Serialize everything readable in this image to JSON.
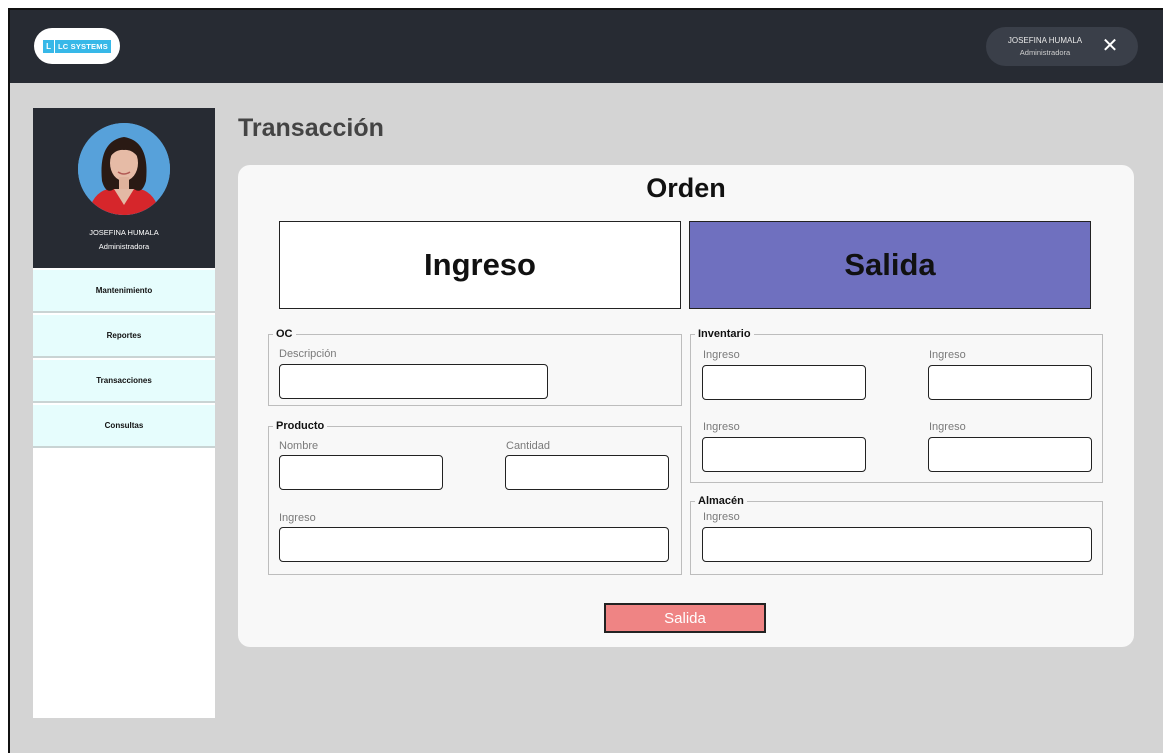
{
  "header": {
    "logo": {
      "mark": "L",
      "text": "LC SYSTEMS"
    },
    "user": {
      "name": "JOSEFINA HUMALA",
      "role": "Administradora"
    },
    "close_icon": "✕"
  },
  "sidebar": {
    "profile": {
      "name": "JOSEFINA HUMALA",
      "role": "Administradora",
      "avatar": "profile-photo"
    },
    "items": [
      {
        "label": "Mantenimiento"
      },
      {
        "label": "Reportes"
      },
      {
        "label": "Transacciones"
      },
      {
        "label": "Consultas"
      }
    ]
  },
  "main": {
    "page_title": "Transacción",
    "card": {
      "title": "Orden",
      "tabs": {
        "ingreso": "Ingreso",
        "salida": "Salida"
      },
      "oc": {
        "legend": "OC",
        "descripcion_label": "Descripción",
        "descripcion_value": ""
      },
      "producto": {
        "legend": "Producto",
        "nombre_label": "Nombre",
        "cantidad_label": "Cantidad",
        "ingreso_label": "Ingreso"
      },
      "inventario": {
        "legend": "Inventario",
        "labels": [
          "Ingreso",
          "Ingreso",
          "Ingreso",
          "Ingreso"
        ]
      },
      "almacen": {
        "legend": "Almacén",
        "ingreso_label": "Ingreso"
      },
      "submit_label": "Salida"
    }
  },
  "colors": {
    "topbar": "#272b33",
    "background": "#d4d4d4",
    "salida_tab": "#6f70bf",
    "submit": "#ef8484",
    "menu_item": "#e6fdfd",
    "logo_badge": "#37b8e8"
  }
}
